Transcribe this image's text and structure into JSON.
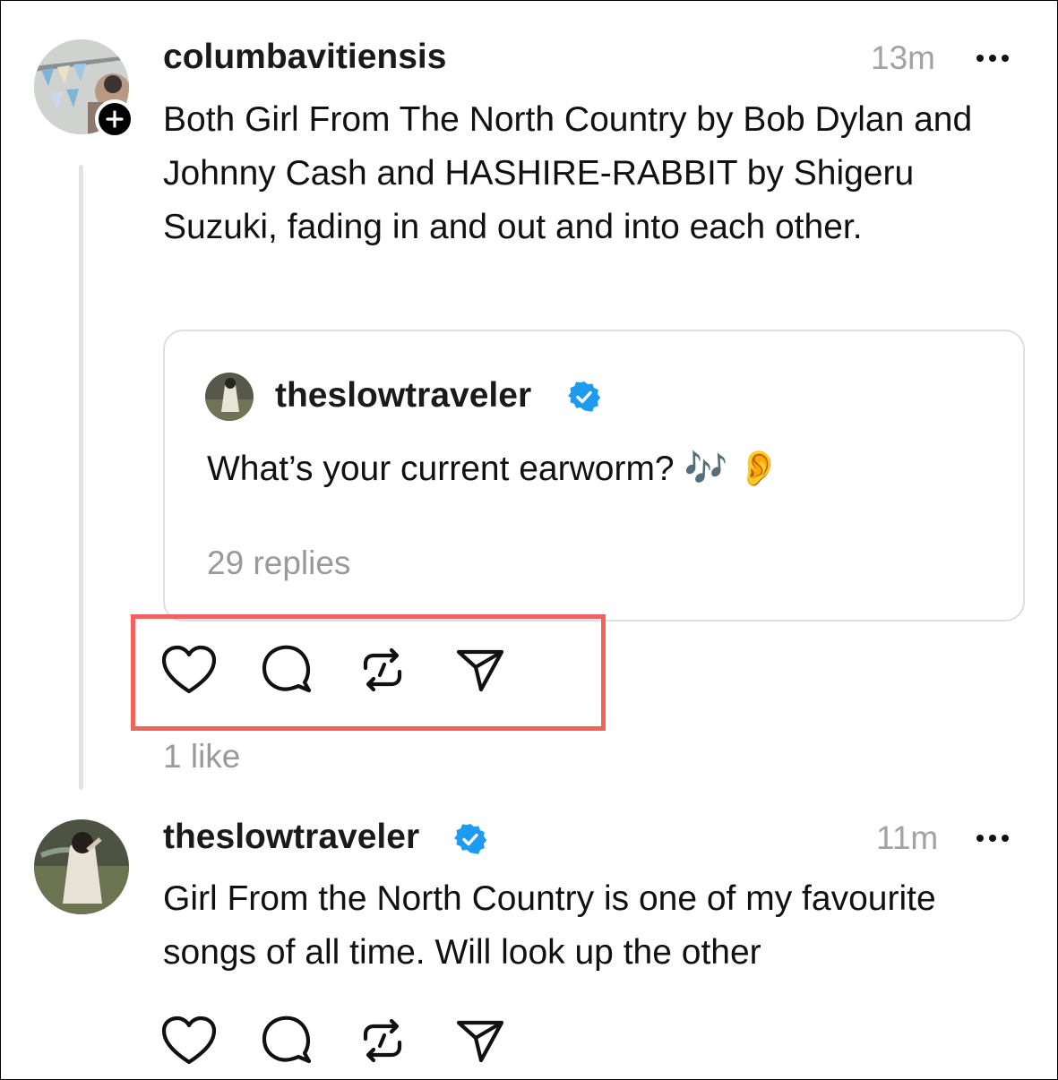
{
  "post": {
    "username": "columbavitiensis",
    "time": "13m",
    "text": "Both Girl From The North Country by Bob Dylan and Johnny Cash and HASHIRE-RABBIT by Shigeru Suzuki, fading in and out and into each other.",
    "likes": "1 like"
  },
  "quote": {
    "username": "theslowtraveler",
    "text": "What’s your current earworm? 🎶 👂",
    "replies": "29 replies"
  },
  "reply": {
    "username": "theslowtraveler",
    "time": "11m",
    "text": "Girl From the North Country is one of my favourite songs of all time. Will look up the other"
  },
  "colors": {
    "verified": "#1d9bf0",
    "highlight": "#f0625a",
    "muted": "#9a9a9a"
  },
  "icons": [
    "heart-icon",
    "comment-icon",
    "repost-icon",
    "share-icon",
    "more-icon",
    "plus-icon",
    "verified-icon"
  ]
}
